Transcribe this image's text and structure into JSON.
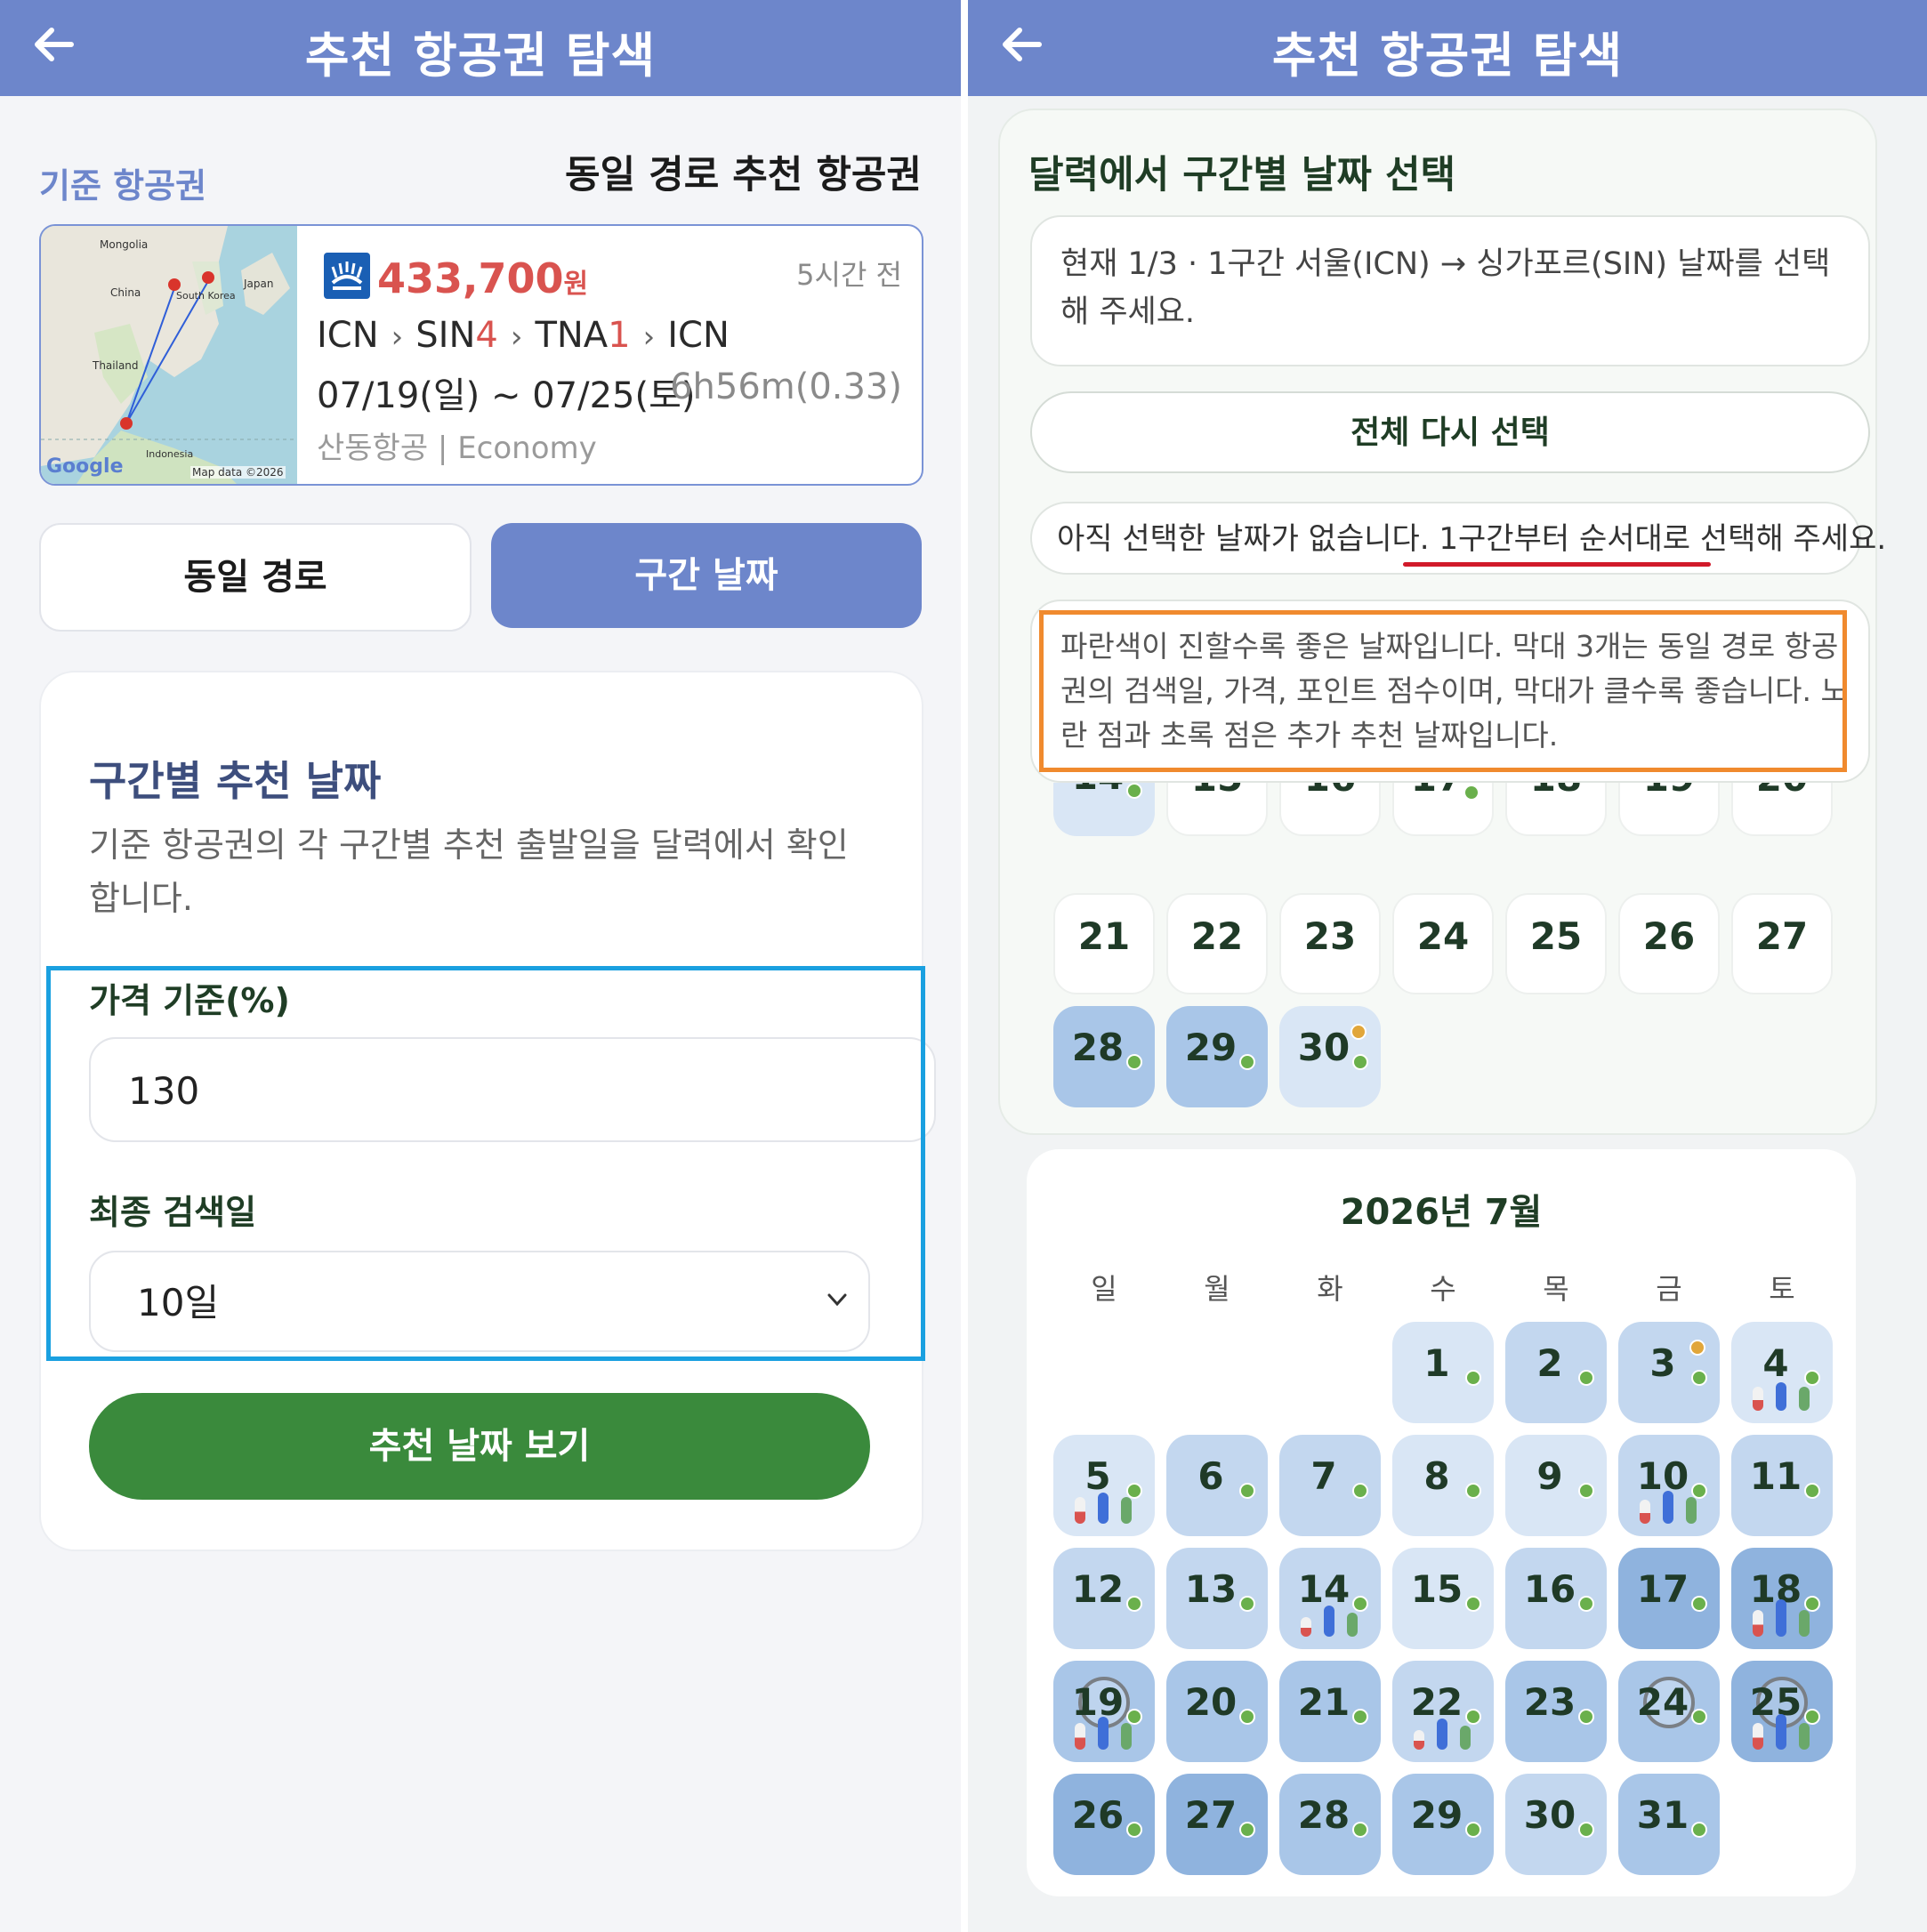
{
  "left": {
    "appbar": {
      "title": "추천 항공권 탐색",
      "back_icon": "arrow-left-icon"
    },
    "base_label": "기준 항공권",
    "same_route_title": "동일 경로 추천 항공권",
    "flight": {
      "price": "433,700",
      "price_unit": "원",
      "time_ago": "5시간 전",
      "route": [
        "ICN",
        "SIN",
        "4",
        "TNA",
        "1",
        "ICN"
      ],
      "dates": "07/19(일) ~ 07/25(토)",
      "duration": "6h56m(0.33)",
      "airline": "산동항공 | Economy",
      "map_labels": {
        "mongolia": "Mongolia",
        "china": "China",
        "korea": "South Korea",
        "japan": "Japan",
        "thailand": "Thailand",
        "indonesia": "Indonesia",
        "google": "Google",
        "attribution": "Map data ©2026"
      }
    },
    "tabs": {
      "same_route": "동일 경로",
      "segment_date": "구간 날짜"
    },
    "rec": {
      "title": "구간별 추천 날짜",
      "desc": "기준 항공권의 각 구간별 추천 출발일을 달력에서 확인합니다.",
      "price_label": "가격 기준(%)",
      "price_value": "130",
      "search_label": "최종 검색일",
      "search_value": "10일",
      "button": "추천 날짜 보기"
    }
  },
  "right": {
    "appbar": {
      "title": "추천 항공권 탐색",
      "back_icon": "arrow-left-icon"
    },
    "cal_title": "달력에서 구간별 날짜 선택",
    "info": "현재 1/3 · 1구간 서울(ICN) → 싱가포르(SIN) 날짜를 선택해 주세요.",
    "reset": "전체 다시 선택",
    "status": "아직 선택한 날짜가 없습니다. 1구간부터 순서대로 선택해 주세요.",
    "legend": "파란색이 진할수록 좋은 날짜입니다. 막대 3개는 동일 경로 항공권의 검색일, 가격, 포인트 점수이며, 막대가 클수록 좋습니다. 노란 점과 초록 점은 추가 추천 날짜입니다.",
    "june_rows": [
      [
        "14",
        "15",
        "16",
        "17",
        "18",
        "19",
        "20"
      ],
      [
        "21",
        "22",
        "23",
        "24",
        "25",
        "26",
        "27"
      ],
      [
        "28",
        "29",
        "30"
      ]
    ],
    "july": {
      "title": "2026년 7월",
      "weekdays": [
        "일",
        "월",
        "화",
        "수",
        "목",
        "금",
        "토"
      ],
      "days": [
        "1",
        "2",
        "3",
        "4",
        "5",
        "6",
        "7",
        "8",
        "9",
        "10",
        "11",
        "12",
        "13",
        "14",
        "15",
        "16",
        "17",
        "18",
        "19",
        "20",
        "21",
        "22",
        "23",
        "24",
        "25",
        "26",
        "27",
        "28",
        "29",
        "30",
        "31"
      ]
    },
    "colors": {
      "blue1": "#d9e6f5",
      "blue2": "#c3d7ef",
      "blue3": "#a9c6e8",
      "blue4": "#8fb3de",
      "bar_red": "#d9534f",
      "bar_blue": "#3f6fd8",
      "bar_green": "#6aa86a",
      "dot_green": "#6ab04c",
      "dot_orange": "#e1a63a"
    }
  }
}
